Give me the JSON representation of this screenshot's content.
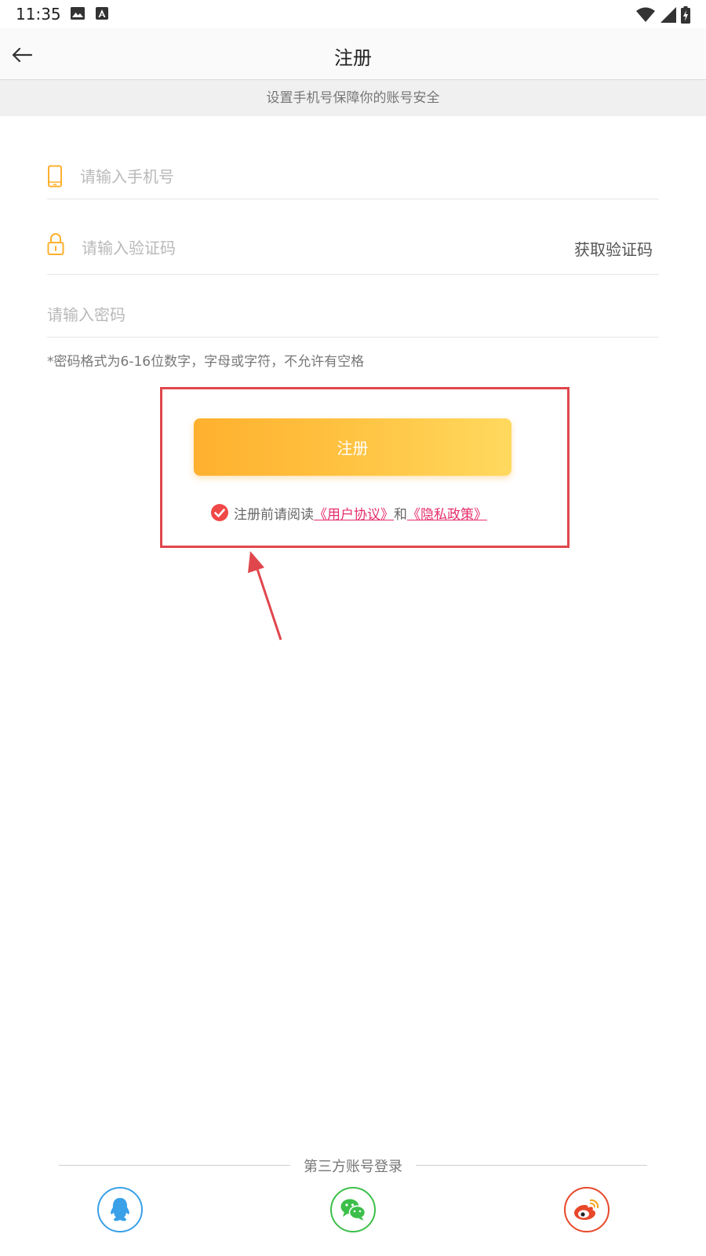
{
  "status_bar": {
    "time": "11:35"
  },
  "app_bar": {
    "title": "注册"
  },
  "subtitle": "设置手机号保障你的账号安全",
  "form": {
    "phone_placeholder": "请输入手机号",
    "code_placeholder": "请输入验证码",
    "get_code_label": "获取验证码",
    "password_placeholder": "请输入密码",
    "password_hint": "*密码格式为6-16位数字，字母或字符，不允许有空格"
  },
  "register_button_label": "注册",
  "agreement": {
    "prefix": "注册前请阅读",
    "user_agreement": "《用户协议》",
    "conjunction": "和",
    "privacy_policy": "《隐私政策》",
    "checked": true
  },
  "third_party": {
    "label": "第三方账号登录"
  },
  "colors": {
    "accent": "#FFB02E",
    "link": "#E62E6B",
    "annotation": "#E0474C",
    "qq": "#3AA0E8",
    "wechat": "#3CBF4A",
    "weibo": "#E8482A"
  },
  "icons": {
    "status": [
      "image-icon",
      "keyboard-icon",
      "wifi-icon",
      "signal-icon",
      "battery-charging-icon"
    ],
    "back": "arrow-left-icon",
    "phone_field": "phone-icon",
    "code_field": "lock-icon",
    "agree": "check-circle-icon",
    "social": [
      "qq-icon",
      "wechat-icon",
      "weibo-icon"
    ]
  }
}
